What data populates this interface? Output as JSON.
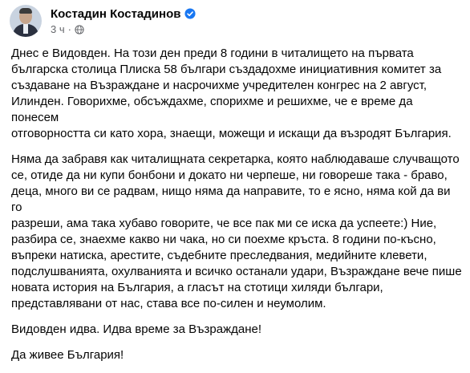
{
  "post": {
    "author": "Костадин Костадинов",
    "timestamp": "3 ч",
    "separator": "·",
    "paragraphs": [
      "Днес е Видовден. На този ден преди 8 години в читалището на първата\nбългарска столица Плиска 58 българи създадохме инициативния комитет за\nсъздаване на Възраждане и насрочихме учредителен конгрес на 2 август,\nИлинден. Говорихме, обсъждахме, спорихме и решихме, че е време да понесем\nотговорността си като хора, знаещи, можещи и искащи да възродят България.",
      "Няма да забравя как читалищната секретарка, която наблюдаваше случващото\nсе, отиде да ни купи бонбони и докато ни черпеше, ни говореше така - браво,\nдеца, много ви се радвам, нищо няма да направите, то е ясно, няма кой да ви го\nразреши, ама така хубаво говорите, че все пак ми се иска да успеете:) Ние,\nразбира се, знаехме какво ни чака, но си поехме кръста. 8 години по-късно,\nвъпреки натиска, арестите, съдебните преследвания, медийните клевети,\nподслушванията, охулванията и всичко останали удари, Възраждане вече пише\nновата история на България, а гласът на стотици хиляди българи,\nпредставлявани от нас, става все по-силен и неумолим.",
      "Видовден идва. Идва време за Възраждане!",
      "Да живее България!"
    ]
  },
  "colors": {
    "verified_badge": "#1877f2",
    "meta_text": "#65676b",
    "body_text": "#050505"
  },
  "icons": {
    "verified": "verified-badge-icon",
    "audience": "globe-icon"
  }
}
